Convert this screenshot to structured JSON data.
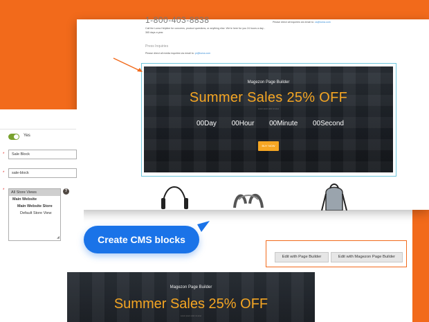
{
  "storefront": {
    "phone": "1-800-403-8838",
    "help_text": "Call the Luma Helpline for concerns, product questions, or anything else. We're here for you 24 hours a day - 365 days a year.",
    "email_text": "Please direct all inquiries via email to:",
    "email_link": "cs@luma.com",
    "press_title": "Press Inquiries",
    "press_text": "Please direct all media inquiries via email to:",
    "press_link": "pr@luma.com"
  },
  "banner": {
    "subtitle": "Magezon Page Builder",
    "title": "Summer Sales 25% OFF",
    "tagline": "Lorem ipsum dolor sit amet",
    "countdown": [
      {
        "value": "00",
        "unit": "Day"
      },
      {
        "value": "00",
        "unit": "Hour"
      },
      {
        "value": "00",
        "unit": "Minute"
      },
      {
        "value": "00",
        "unit": "Second"
      }
    ],
    "button": "BUY NOW"
  },
  "form": {
    "enable_label": "Yes",
    "title_value": "Sale Block",
    "identifier_value": "sale-block",
    "store_views": [
      "All Store Views",
      "Main Website",
      "Main Website Store",
      "Default Store View"
    ],
    "help_icon": "?"
  },
  "callout": {
    "label": "Create CMS blocks"
  },
  "actions": {
    "edit_page_builder": "Edit with Page Builder",
    "edit_magezon": "Edit with Magezon Page Builder"
  },
  "banner2": {
    "subtitle": "Magezon Page Builder",
    "title": "Summer Sales 25% OFF",
    "tagline": "Lorem ipsum dolor sit amet"
  },
  "colors": {
    "brand_orange": "#f26a1b",
    "accent_blue": "#1a73e8",
    "banner_gold": "#f5a623",
    "highlight_cyan": "#6ec6dc",
    "toggle_green": "#79a22e"
  },
  "icons": [
    "orange-arrow-icon",
    "help-icon",
    "resize-handle-icon",
    "speech-tail-icon"
  ]
}
